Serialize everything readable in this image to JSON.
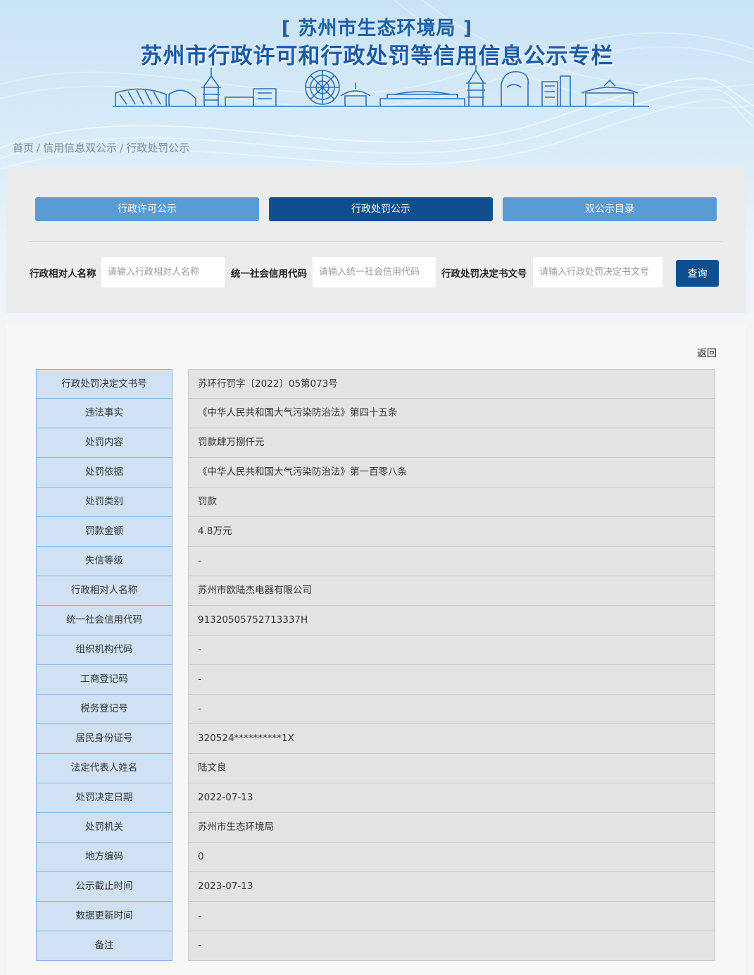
{
  "header": {
    "org_title": "[ 苏州市生态环境局 ]",
    "main_title": "苏州市行政许可和行政处罚等信用信息公示专栏"
  },
  "breadcrumb": {
    "home": "首页",
    "level2": "信用信息双公示",
    "current": "行政处罚公示",
    "separator": "/"
  },
  "tabs": [
    {
      "label": "行政许可公示",
      "active": false
    },
    {
      "label": "行政处罚公示",
      "active": true
    },
    {
      "label": "双公示目录",
      "active": false
    }
  ],
  "search": {
    "party_name_label": "行政相对人名称",
    "party_name_placeholder": "请输入行政相对人名称",
    "credit_code_label": "统一社会信用代码",
    "credit_code_placeholder": "请输入统一社会信用代码",
    "decision_no_label": "行政处罚决定书文号",
    "decision_no_placeholder": "请输入行政处罚决定书文号",
    "query_button": "查询"
  },
  "detail": {
    "back_label": "返回",
    "rows": [
      {
        "label": "行政处罚决定文书号",
        "value": "苏环行罚字〔2022〕05第073号"
      },
      {
        "label": "违法事实",
        "value": "《中华人民共和国大气污染防治法》第四十五条"
      },
      {
        "label": "处罚内容",
        "value": "罚款肆万捌仟元"
      },
      {
        "label": "处罚依据",
        "value": "《中华人民共和国大气污染防治法》第一百零八条"
      },
      {
        "label": "处罚类别",
        "value": "罚款"
      },
      {
        "label": "罚款金额",
        "value": "4.8万元"
      },
      {
        "label": "失信等级",
        "value": "-"
      },
      {
        "label": "行政相对人名称",
        "value": "苏州市欧陆杰电器有限公司"
      },
      {
        "label": "统一社会信用代码",
        "value": "91320505752713337H"
      },
      {
        "label": "组织机构代码",
        "value": "-"
      },
      {
        "label": "工商登记码",
        "value": "-"
      },
      {
        "label": "税务登记号",
        "value": "-"
      },
      {
        "label": "居民身份证号",
        "value": "320524**********1X"
      },
      {
        "label": "法定代表人姓名",
        "value": "陆文良"
      },
      {
        "label": "处罚决定日期",
        "value": "2022-07-13"
      },
      {
        "label": "处罚机关",
        "value": "苏州市生态环境局"
      },
      {
        "label": "地方编码",
        "value": "0"
      },
      {
        "label": "公示截止时间",
        "value": "2023-07-13"
      },
      {
        "label": "数据更新时间",
        "value": "-"
      },
      {
        "label": "备注",
        "value": "-"
      }
    ]
  },
  "colors": {
    "title_blue": "#1a5aa6",
    "tab_active": "#0e4f8f",
    "tab_inactive": "#5a9bd4",
    "label_cell_bg": "#cfe1f2",
    "value_cell_bg": "#e3e3e3"
  }
}
